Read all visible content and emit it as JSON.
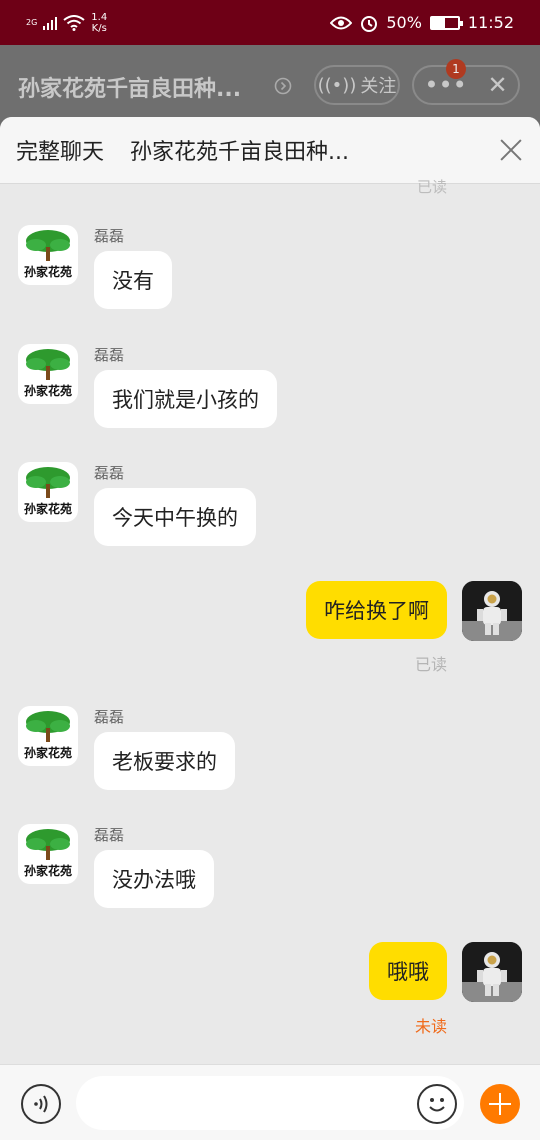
{
  "status_bar": {
    "network_top": "2G",
    "speed_value": "1.4",
    "speed_unit": "K/s",
    "battery_percent": "50%",
    "battery_level": 0.5,
    "time": "11:52"
  },
  "background_page": {
    "shop_title": "孙家花苑千亩良田种...",
    "follow_label": "关注",
    "more_icon": "ellipsis-icon",
    "notification_count": "1",
    "close_icon": "close-icon"
  },
  "sheet": {
    "title": "完整聊天",
    "subtitle": "孙家花苑千亩良田种...",
    "close_icon": "close-icon"
  },
  "chat": {
    "top_read_status": "已读",
    "messages": [
      {
        "side": "left",
        "sender": "磊磊",
        "text": "没有",
        "avatar_label": "孙家花苑"
      },
      {
        "side": "left",
        "sender": "磊磊",
        "text": "我们就是小孩的",
        "avatar_label": "孙家花苑"
      },
      {
        "side": "left",
        "sender": "磊磊",
        "text": "今天中午换的",
        "avatar_label": "孙家花苑"
      },
      {
        "side": "right",
        "text": "咋给换了啊",
        "status": "已读"
      },
      {
        "side": "left",
        "sender": "磊磊",
        "text": "老板要求的",
        "avatar_label": "孙家花苑"
      },
      {
        "side": "left",
        "sender": "磊磊",
        "text": "没办法哦",
        "avatar_label": "孙家花苑"
      },
      {
        "side": "right",
        "text": "哦哦",
        "status": "未读"
      }
    ]
  },
  "input_bar": {
    "value": "",
    "voice_icon": "voice-icon",
    "emoji_icon": "emoji-icon",
    "plus_icon": "plus-icon"
  },
  "colors": {
    "status_bar": "#6e0016",
    "own_bubble": "#ffdd00",
    "unread": "#f06a1a",
    "plus_button": "#ff7a00"
  }
}
